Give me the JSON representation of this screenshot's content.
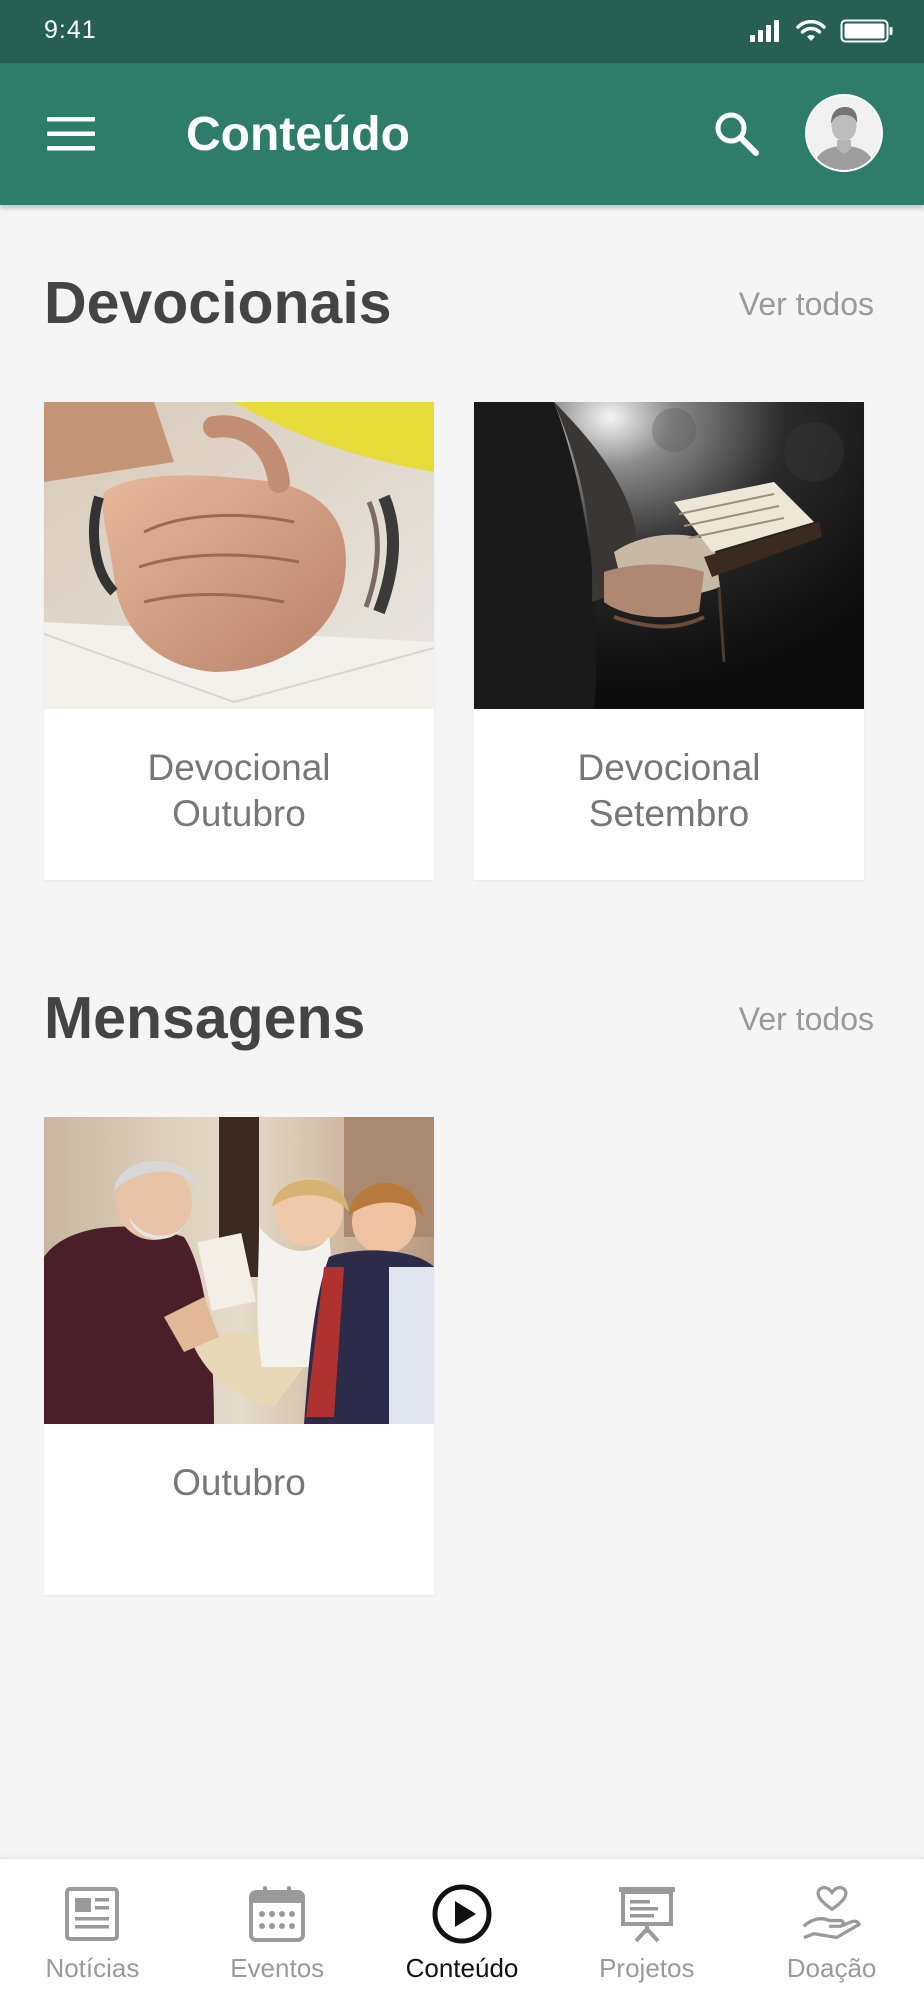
{
  "status_bar": {
    "time": "9:41"
  },
  "app_bar": {
    "title": "Conteúdo"
  },
  "sections": [
    {
      "title": "Devocionais",
      "see_all": "Ver todos",
      "cards": [
        {
          "label": "Devocional Outubro"
        },
        {
          "label": "Devocional Setembro"
        }
      ]
    },
    {
      "title": "Mensagens",
      "see_all": "Ver todos",
      "cards": [
        {
          "label": "Outubro"
        }
      ]
    }
  ],
  "bottom_nav": {
    "items": [
      {
        "label": "Notícias",
        "icon": "newspaper-icon"
      },
      {
        "label": "Eventos",
        "icon": "calendar-icon"
      },
      {
        "label": "Conteúdo",
        "icon": "play-circle-icon",
        "active": true
      },
      {
        "label": "Projetos",
        "icon": "presentation-board-icon"
      },
      {
        "label": "Doação",
        "icon": "donation-hand-icon"
      }
    ]
  },
  "colors": {
    "status_bar": "#265f53",
    "app_bar": "#2e7d6b",
    "background": "#f5f5f5"
  }
}
